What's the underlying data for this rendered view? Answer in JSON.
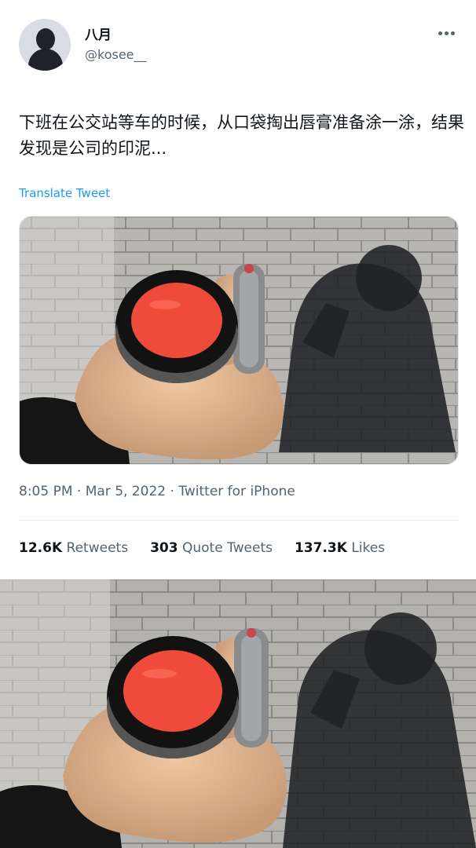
{
  "author": {
    "display_name": "八月",
    "handle": "@kosee__",
    "avatar_icon": "avatar-silhouette-icon"
  },
  "more_icon": "more-options-icon",
  "tweet": {
    "text": "下班在公交站等车的时候，从口袋掏出唇膏准备涂一涂，结果发现是公司的印泥...",
    "translate_label": "Translate Tweet",
    "image_description": "hand holding open red ink pad compact on brick pavement with shadow",
    "timestamp": "8:05 PM · Mar 5, 2022 · Twitter for iPhone"
  },
  "stats": {
    "retweets_count": "12.6K",
    "retweets_label": "Retweets",
    "quotes_count": "303",
    "quotes_label": "Quote Tweets",
    "likes_count": "137.3K",
    "likes_label": "Likes"
  },
  "colors": {
    "link": "#1d9bf0",
    "secondary_text": "#536471",
    "ink_red": "#f04a3a"
  }
}
